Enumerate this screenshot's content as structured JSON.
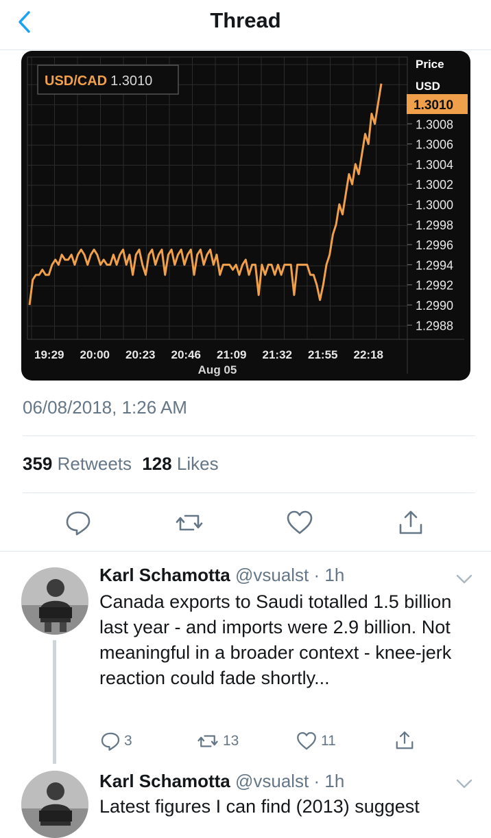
{
  "nav": {
    "title": "Thread"
  },
  "chart_data": {
    "type": "line",
    "title": "USD/CAD",
    "price_label": "1.3010",
    "axis_header": [
      "Price",
      "USD"
    ],
    "current_value": "1.3010",
    "x_ticks": [
      "19:29",
      "20:00",
      "20:23",
      "20:46",
      "21:09",
      "21:32",
      "21:55",
      "22:18"
    ],
    "x_sublabel": "Aug 05",
    "y_ticks": [
      "1.3008",
      "1.3006",
      "1.3004",
      "1.3002",
      "1.3000",
      "1.2998",
      "1.2996",
      "1.2994",
      "1.2992",
      "1.2990",
      "1.2988"
    ],
    "ylim": [
      1.2987,
      1.301
    ],
    "grid": true,
    "line_color": "#f0a04b",
    "values": [
      1.2988,
      1.29905,
      1.2991,
      1.2991,
      1.29915,
      1.2991,
      1.2991,
      1.2992,
      1.29925,
      1.2992,
      1.2993,
      1.29925,
      1.29925,
      1.2993,
      1.2992,
      1.2993,
      1.29935,
      1.2993,
      1.2992,
      1.2993,
      1.29935,
      1.2993,
      1.2992,
      1.29925,
      1.2992,
      1.2992,
      1.2993,
      1.2992,
      1.2993,
      1.29935,
      1.2992,
      1.2993,
      1.2991,
      1.2993,
      1.29935,
      1.2992,
      1.2991,
      1.2993,
      1.29935,
      1.2992,
      1.2993,
      1.29935,
      1.2991,
      1.2993,
      1.29935,
      1.2992,
      1.2993,
      1.29935,
      1.2992,
      1.2993,
      1.29935,
      1.2991,
      1.2993,
      1.29935,
      1.2992,
      1.2993,
      1.29935,
      1.2992,
      1.2993,
      1.2991,
      1.2992,
      1.2992,
      1.2992,
      1.29915,
      1.2992,
      1.2991,
      1.2992,
      1.29925,
      1.2991,
      1.2992,
      1.2992,
      1.2989,
      1.2992,
      1.2991,
      1.2992,
      1.2992,
      1.2991,
      1.2992,
      1.2991,
      1.2992,
      1.2992,
      1.2992,
      1.2989,
      1.2992,
      1.2992,
      1.2992,
      1.2992,
      1.2991,
      1.2991,
      1.299,
      1.29885,
      1.299,
      1.2992,
      1.2993,
      1.2995,
      1.2996,
      1.2998,
      1.2997,
      1.2999,
      1.3001,
      1.3,
      1.3002,
      1.3001,
      1.3003,
      1.3005,
      1.3004,
      1.3007,
      1.3006,
      1.3008,
      1.301
    ]
  },
  "tweet": {
    "timestamp": "06/08/2018, 1:26 AM",
    "retweets_count": "359",
    "retweets_label": "Retweets",
    "likes_count": "128",
    "likes_label": "Likes"
  },
  "replies": [
    {
      "name": "Karl Schamotta",
      "handle": "@vsualst · 1h",
      "text": "Canada exports to Saudi totalled 1.5 billion last year - and imports were 2.9 billion. Not meaningful in a broader context - knee-jerk reaction could fade shortly...",
      "reply_count": "3",
      "retweet_count": "13",
      "like_count": "11"
    },
    {
      "name": "Karl Schamotta",
      "handle": "@vsualst · 1h",
      "text": "Latest figures I can find (2013) suggest"
    }
  ],
  "colors": {
    "accent": "#1da1f2",
    "muted": "#657786",
    "chart_line": "#f0a04b"
  }
}
